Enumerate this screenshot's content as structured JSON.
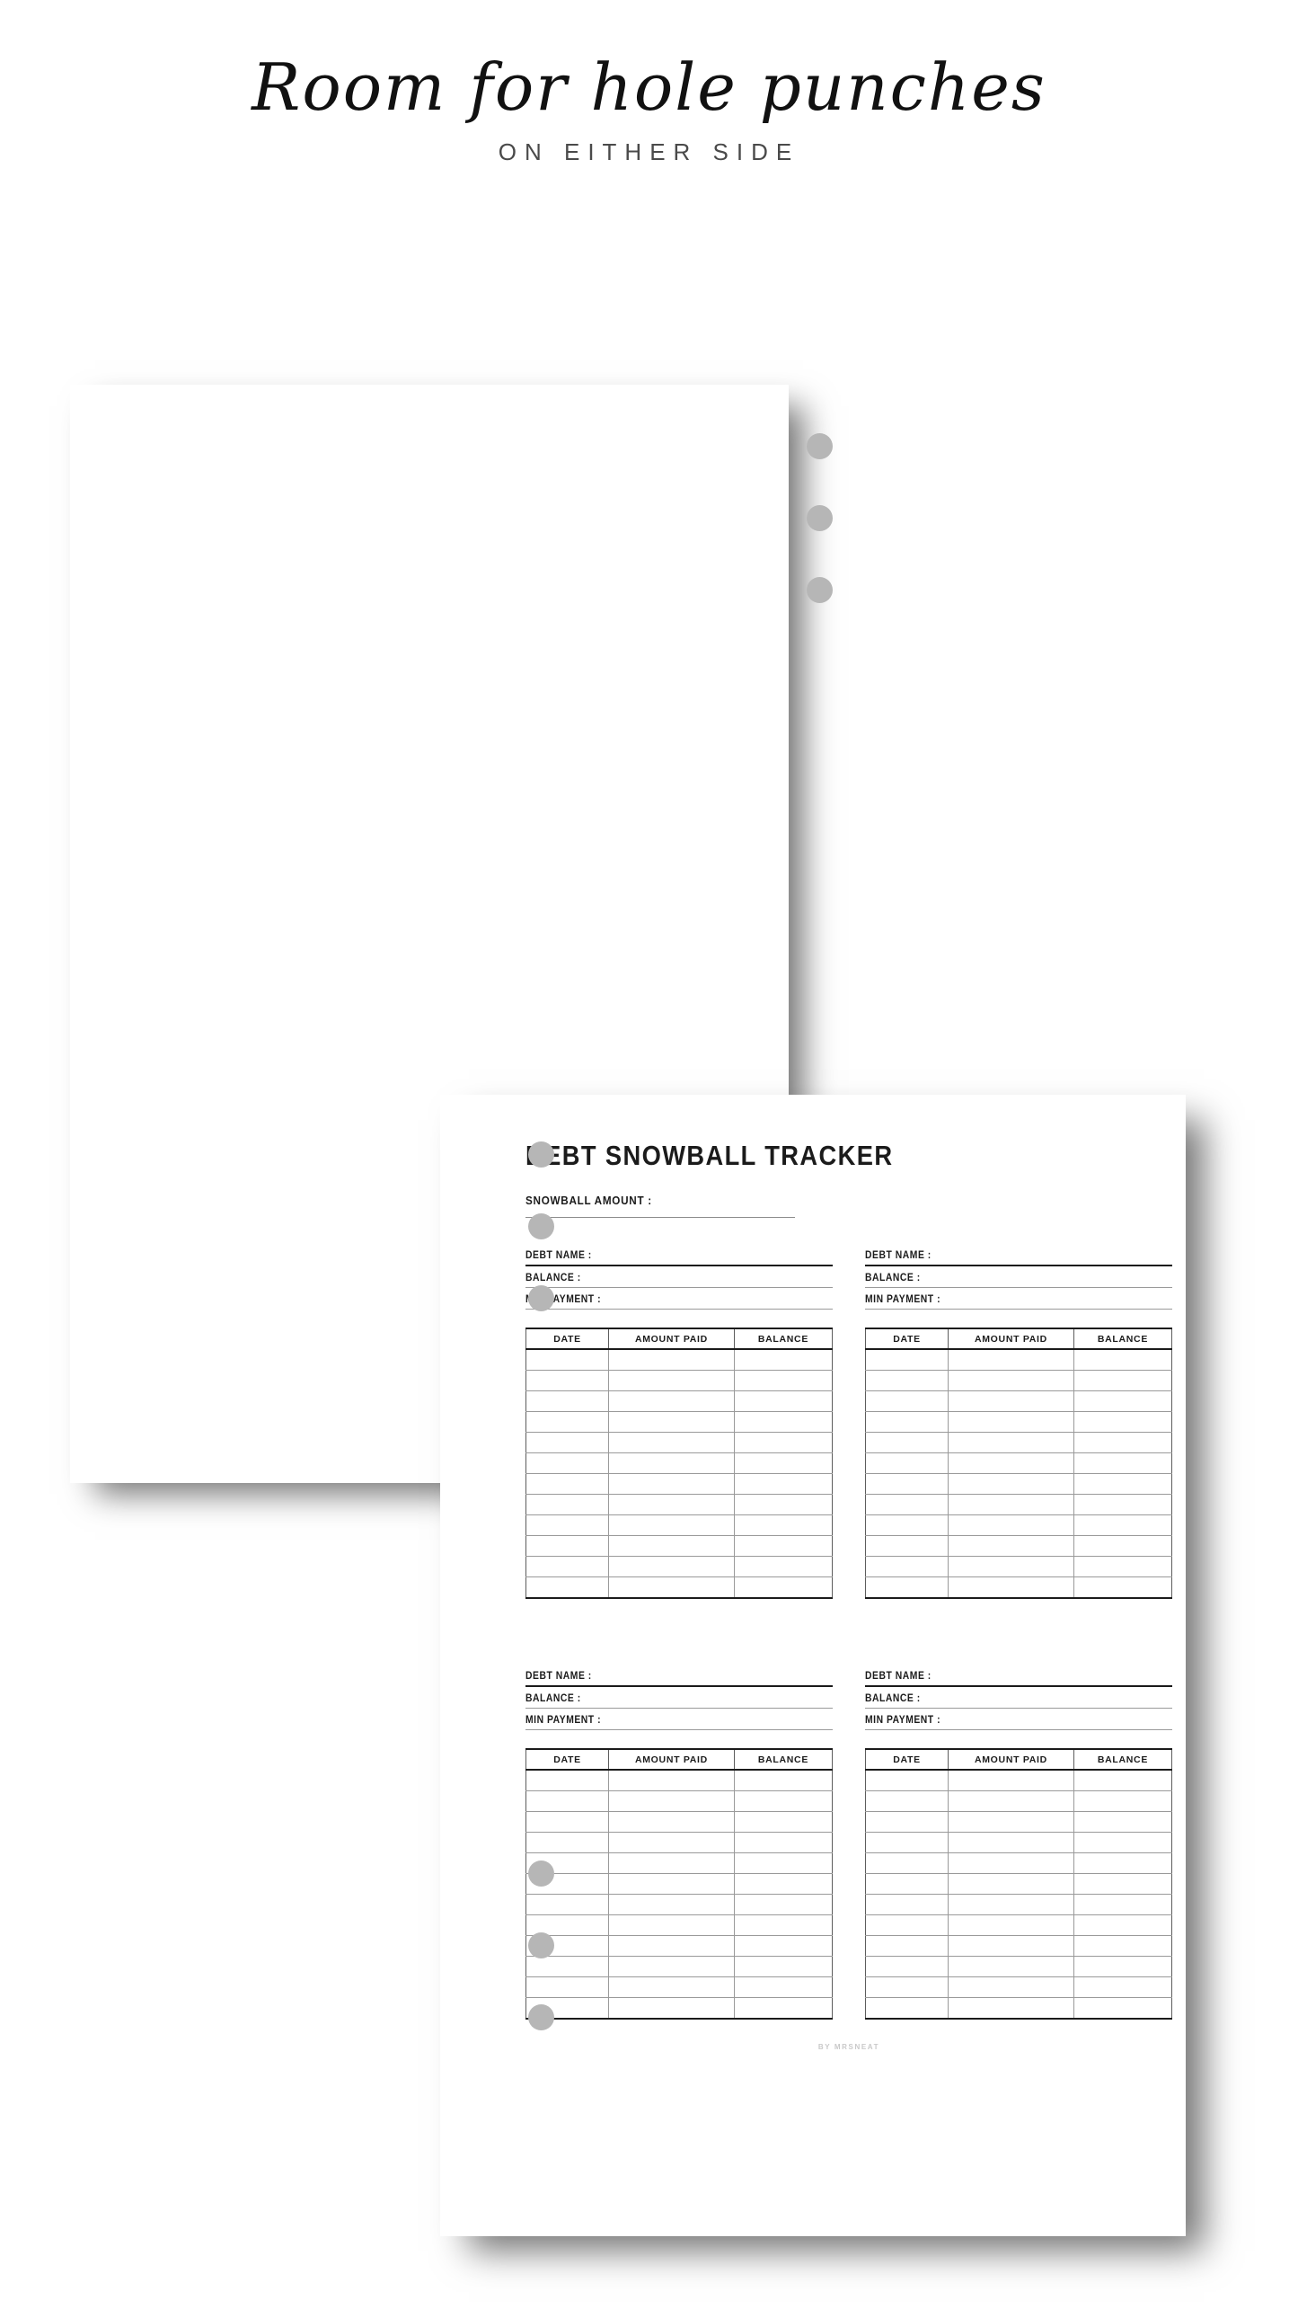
{
  "heading": {
    "script_line": "Room for hole punches",
    "sub_line": "ON EITHER SIDE"
  },
  "colors": {
    "ink": "#1b1b1b",
    "rule_light": "#9a9a9a",
    "punch": "#b6b6b6",
    "footer": "#c9c9c9",
    "page_bg": "#ffffff"
  },
  "tracker": {
    "title": "DEBT SNOWBALL TRACKER",
    "snowball_label": "SNOWBALL AMOUNT :",
    "fields": {
      "debt_name": "DEBT NAME :",
      "balance": "BALANCE :",
      "min_payment": "MIN PAYMENT :"
    },
    "table": {
      "headers": [
        "DATE",
        "AMOUNT PAID",
        "BALANCE"
      ],
      "row_count": 12,
      "rows": [
        [
          "",
          "",
          ""
        ],
        [
          "",
          "",
          ""
        ],
        [
          "",
          "",
          ""
        ],
        [
          "",
          "",
          ""
        ],
        [
          "",
          "",
          ""
        ],
        [
          "",
          "",
          ""
        ],
        [
          "",
          "",
          ""
        ],
        [
          "",
          "",
          ""
        ],
        [
          "",
          "",
          ""
        ],
        [
          "",
          "",
          ""
        ],
        [
          "",
          "",
          ""
        ],
        [
          "",
          "",
          ""
        ]
      ]
    },
    "blocks_per_page": 4,
    "footer_credit": "BY MRSNEAT"
  },
  "sheets": [
    {
      "id": "sheet-back",
      "name": "debt-snowball-tracker-sheet-back",
      "punch_side": "right",
      "punch_count": 3
    },
    {
      "id": "sheet-front",
      "name": "debt-snowball-tracker-sheet-front",
      "punch_side": "left",
      "punch_count": 6
    }
  ]
}
